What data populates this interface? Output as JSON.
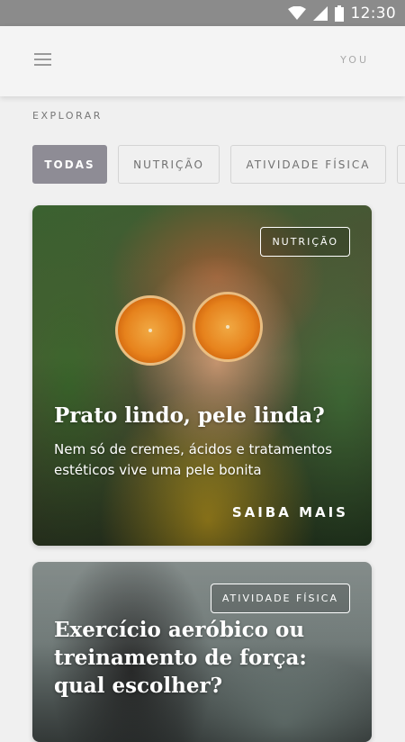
{
  "status_bar": {
    "time": "12:30",
    "icons": [
      "wifi-icon",
      "signal-icon",
      "battery-icon"
    ]
  },
  "app_bar": {
    "menu_icon": "menu-icon",
    "profile_label": "YOU"
  },
  "explore": {
    "title": "EXPLORAR",
    "filters": [
      {
        "label": "TODAS",
        "active": true
      },
      {
        "label": "NUTRIÇÃO",
        "active": false
      },
      {
        "label": "ATIVIDADE FÍSICA",
        "active": false
      },
      {
        "label": "",
        "active": false
      }
    ]
  },
  "cards": [
    {
      "tag": "NUTRIÇÃO",
      "title": "Prato lindo, pele linda?",
      "description": "Nem só de cremes, ácidos e tratamentos estéticos vive uma pele bonita",
      "cta": "SAIBA MAIS"
    },
    {
      "tag": "ATIVIDADE FÍSICA",
      "title": "Exercício aeróbico ou treinamento de força: qual escolher?"
    }
  ],
  "colors": {
    "status_bar": "#8b8b8b",
    "app_bar": "#f4f4f4",
    "background": "#f0f0f0",
    "chip_active": "#8e8c95",
    "chip_border": "#d4d4d4"
  }
}
